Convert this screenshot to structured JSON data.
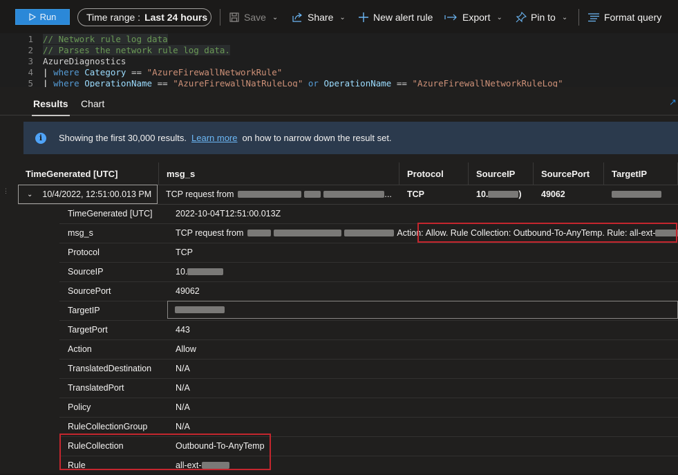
{
  "toolbar": {
    "run_label": "Run",
    "time_range_label": "Time range :",
    "time_range_value": "Last 24 hours",
    "save_label": "Save",
    "share_label": "Share",
    "new_alert_label": "New alert rule",
    "export_label": "Export",
    "pin_label": "Pin to",
    "format_label": "Format query"
  },
  "editor": {
    "line_numbers": [
      "1",
      "2",
      "3",
      "4",
      "5"
    ],
    "l1": "// Network rule log data",
    "l2": "// Parses the network rule log data.",
    "l3": "AzureDiagnostics",
    "l4_pipe": "|",
    "l4_kw": "where",
    "l4_field": "Category",
    "l4_op": "==",
    "l4_str": "\"AzureFirewallNetworkRule\"",
    "l5_pipe": "|",
    "l5_kw": "where",
    "l5_field": "OperationName",
    "l5_op": "==",
    "l5_str": "\"AzureFirewallNatRuleLog\"",
    "l5_or": "or",
    "l5_field2": "OperationName",
    "l5_op2": "==",
    "l5_str2": "\"AzureFirewallNetworkRuleLog\""
  },
  "tabs": {
    "results": "Results",
    "chart": "Chart"
  },
  "info": {
    "text_before": "Showing the first 30,000 results.",
    "link": "Learn more",
    "text_after": "on how to narrow down the result set."
  },
  "grid": {
    "headers": [
      "TimeGenerated [UTC]",
      "msg_s",
      "Protocol",
      "SourceIP",
      "SourcePort",
      "TargetIP"
    ],
    "row": {
      "time": "10/4/2022, 12:51:00.013 PM",
      "msg_prefix": "TCP request from",
      "msg_suffix": "...",
      "protocol": "TCP",
      "source_ip_prefix": "10.",
      "source_ip_suffix": ")",
      "source_port": "49062"
    }
  },
  "details": {
    "time_key": "TimeGenerated [UTC]",
    "time_val": "2022-10-04T12:51:00.013Z",
    "msg_key": "msg_s",
    "msg_prefix": "TCP request from",
    "msg_action": "Action:",
    "msg_highlight": "Allow. Rule Collection: Outbound-To-AnyTemp. Rule: all-ext-",
    "protocol_key": "Protocol",
    "protocol_val": "TCP",
    "source_ip_key": "SourceIP",
    "source_ip_val": "10.",
    "source_port_key": "SourcePort",
    "source_port_val": "49062",
    "target_ip_key": "TargetIP",
    "target_port_key": "TargetPort",
    "target_port_val": "443",
    "action_key": "Action",
    "action_val": "Allow",
    "tdest_key": "TranslatedDestination",
    "tdest_val": "N/A",
    "tport_key": "TranslatedPort",
    "tport_val": "N/A",
    "policy_key": "Policy",
    "policy_val": "N/A",
    "rcg_key": "RuleCollectionGroup",
    "rcg_val": "N/A",
    "rc_key": "RuleCollection",
    "rc_val": "Outbound-To-AnyTemp",
    "rule_key": "Rule",
    "rule_val": "all-ext-"
  }
}
